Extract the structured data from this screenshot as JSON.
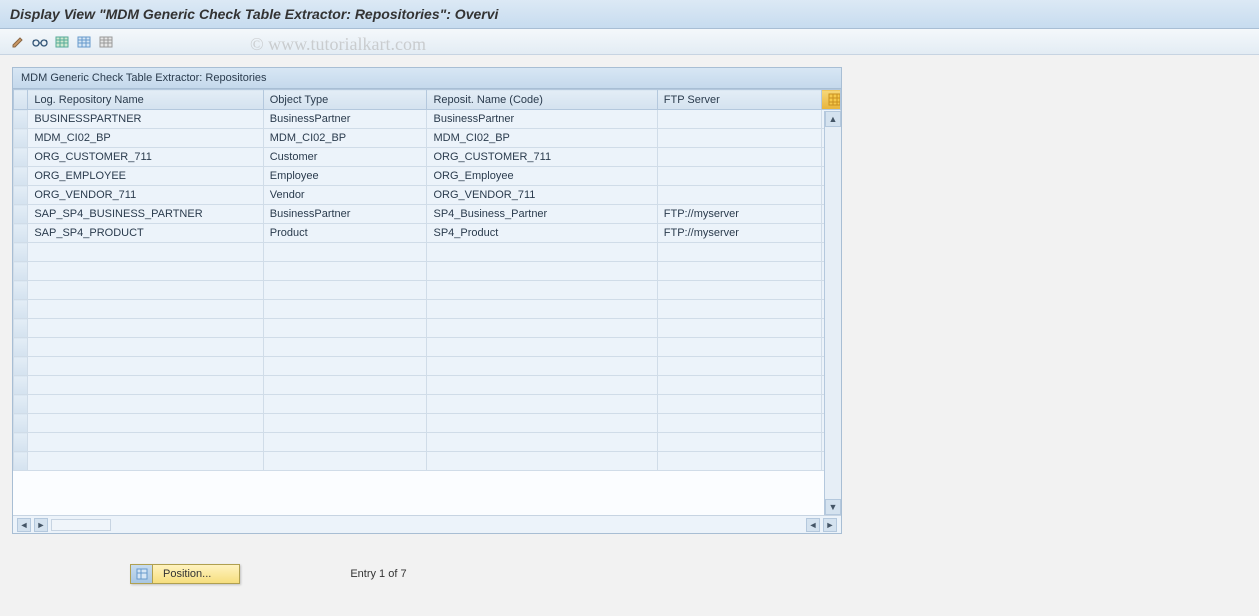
{
  "title": "Display View \"MDM Generic Check Table Extractor: Repositories\": Overvi",
  "watermark": "© www.tutorialkart.com",
  "toolbar": {
    "icons": [
      "edit-icon",
      "glasses-icon",
      "table-green-icon",
      "table-blue-icon",
      "table-grey-icon"
    ]
  },
  "panel": {
    "header": "MDM Generic Check Table Extractor: Repositories"
  },
  "columns": {
    "log": "Log. Repository Name",
    "obj": "Object Type",
    "rep": "Reposit. Name (Code)",
    "ftp": "FTP Server"
  },
  "rows": [
    {
      "log": "BUSINESSPARTNER",
      "obj": "BusinessPartner",
      "rep": "BusinessPartner",
      "ftp": ""
    },
    {
      "log": "MDM_CI02_BP",
      "obj": "MDM_CI02_BP",
      "rep": "MDM_CI02_BP",
      "ftp": ""
    },
    {
      "log": "ORG_CUSTOMER_711",
      "obj": "Customer",
      "rep": "ORG_CUSTOMER_711",
      "ftp": ""
    },
    {
      "log": "ORG_EMPLOYEE",
      "obj": "Employee",
      "rep": "ORG_Employee",
      "ftp": ""
    },
    {
      "log": "ORG_VENDOR_711",
      "obj": "Vendor",
      "rep": "ORG_VENDOR_711",
      "ftp": ""
    },
    {
      "log": "SAP_SP4_BUSINESS_PARTNER",
      "obj": "BusinessPartner",
      "rep": "SP4_Business_Partner",
      "ftp": "FTP://myserver"
    },
    {
      "log": "SAP_SP4_PRODUCT",
      "obj": "Product",
      "rep": "SP4_Product",
      "ftp": "FTP://myserver"
    }
  ],
  "empty_rows": 12,
  "footer": {
    "position_label": "Position...",
    "entry_text": "Entry 1 of 7"
  }
}
